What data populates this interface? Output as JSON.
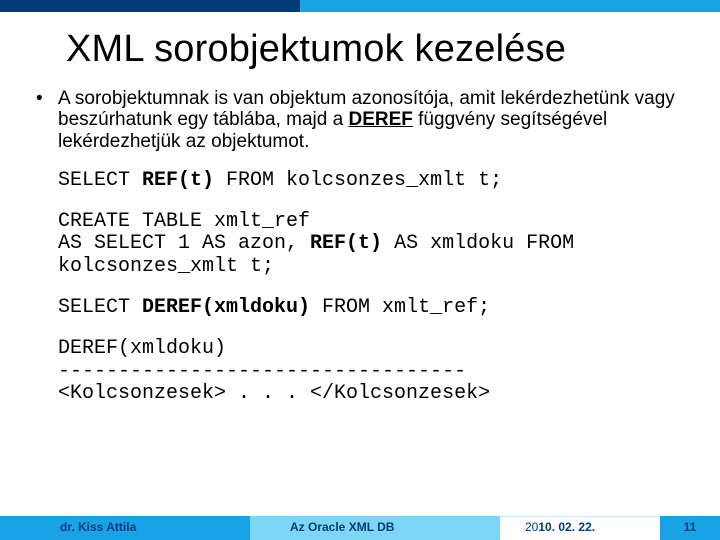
{
  "slide": {
    "title": "XML sorobjektumok kezelése",
    "bullet": {
      "marker": "•",
      "text_part1": "A sorobjektumnak is van objektum azonosítója, amit lekérdezhetünk vagy beszúrhatunk egy táblába, majd a ",
      "deref_word": "DEREF",
      "text_part2": " függvény segítségével lekérdezhetjük az objektumot."
    },
    "code1": {
      "pre": "SELECT ",
      "bold": "REF(t)",
      "post": " FROM kolcsonzes_xmlt t;"
    },
    "code2": {
      "line1": "CREATE TABLE xmlt_ref",
      "line2_pre": "AS SELECT 1 AS azon, ",
      "line2_bold": "REF(t)",
      "line2_post": " AS xmldoku FROM",
      "line3": "kolcsonzes_xmlt t;"
    },
    "code3": {
      "pre": "SELECT ",
      "bold": "DEREF(xmldoku)",
      "post": " FROM xmlt_ref;"
    },
    "code4": {
      "line1": "DEREF(xmldoku)",
      "line2": "----------------------------------",
      "line3": "<Kolcsonzesek> . . . </Kolcsonzesek>"
    }
  },
  "footer": {
    "author": "dr. Kiss Attila",
    "title": "Az Oracle XML DB",
    "date_prefix": "20",
    "date_rest": "10. 02. 22.",
    "page": "11"
  }
}
